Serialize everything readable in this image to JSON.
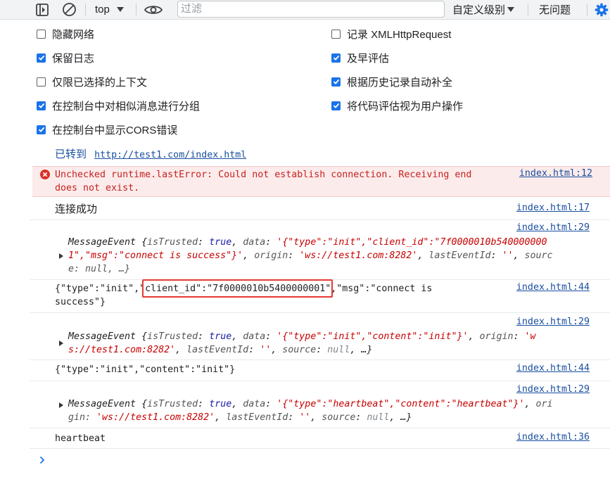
{
  "toolbar": {
    "context": "top",
    "filter_placeholder": "过滤",
    "levels": "自定义级别",
    "issues": "无问题"
  },
  "settings": {
    "left": [
      {
        "label": "隐藏网络",
        "checked": false
      },
      {
        "label": "保留日志",
        "checked": true
      },
      {
        "label": "仅限已选择的上下文",
        "checked": false
      },
      {
        "label": "在控制台中对相似消息进行分组",
        "checked": true
      },
      {
        "label": "在控制台中显示CORS错误",
        "checked": true
      }
    ],
    "right": [
      {
        "label": "记录 XMLHttpRequest",
        "checked": false
      },
      {
        "label": "及早评估",
        "checked": true
      },
      {
        "label": "根据历史记录自动补全",
        "checked": true
      },
      {
        "label": "将代码评估视为用户操作",
        "checked": true
      }
    ]
  },
  "console": {
    "nav": {
      "prefix": "已转到",
      "url": "http://test1.com/index.html"
    },
    "error": {
      "line1": "Unchecked runtime.lastError: Could not establish connection. Receiving end",
      "line2": "does not exist.",
      "source": "index.html:12"
    },
    "log1": {
      "text": "连接成功",
      "source": "index.html:17"
    },
    "event1": {
      "source": "index.html:29",
      "data_line1": "'{\"type\":\"init\",\"client_id\":\"7f0000010b540000000",
      "data_line2": "1\",\"msg\":\"connect is success\"}'",
      "origin": "'ws://test1.com:8282'",
      "tail1": "sourc",
      "tail2": "e: null, …}"
    },
    "log2": {
      "part1": "{\"type\":\"init\",\"",
      "part2": "client_id\":\"7f0000010b5400000001\"",
      "part3": ",\"msg\":\"connect is",
      "line2": "success\"}",
      "source": "index.html:44"
    },
    "event2": {
      "source": "index.html:29",
      "data": "'{\"type\":\"init\",\"content\":\"init\"}'",
      "origin1": "'w",
      "origin2": "s://test1.com:8282'"
    },
    "log3": {
      "text": "{\"type\":\"init\",\"content\":\"init\"}",
      "source": "index.html:44"
    },
    "event3": {
      "source": "index.html:29",
      "data": "'{\"type\":\"heartbeat\",\"content\":\"heartbeat\"}'",
      "tail1": "ori",
      "tail2": "gin:",
      "origin": "'ws://test1.com:8282'"
    },
    "log4": {
      "text": "heartbeat",
      "source": "index.html:36"
    },
    "tokens": {
      "me": "MessageEvent",
      "open": "{",
      "isTrusted": "isTrusted",
      "true": "true",
      "data": "data",
      "origin": "origin",
      "lastEventId": "lastEventId",
      "empty": "''",
      "source": "source",
      "null": "null",
      "ellipsis": "…}",
      "colon": ": ",
      "comma": ", "
    }
  },
  "colors": {
    "accent": "#1a73e8",
    "error_bg": "#fcebeb",
    "error_text": "#c5221f",
    "highlight_box": "#e53935"
  },
  "icons": [
    "dock-sidebar-icon",
    "clear-icon",
    "dropdown-arrow-icon",
    "eye-icon",
    "gear-icon",
    "error-icon",
    "expand-triangle-icon",
    "prompt-chevron-icon"
  ]
}
